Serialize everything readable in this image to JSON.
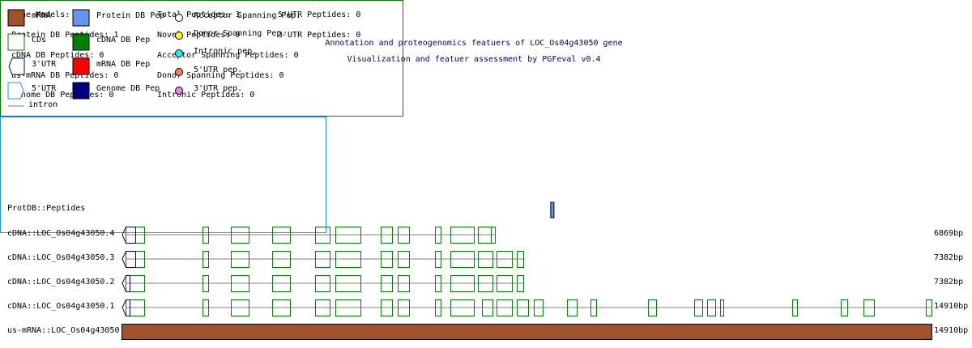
{
  "title": {
    "line1": "Annotation and proteogenomics featuers of LOC_Os04g43050 gene",
    "line2": "Visualization and featuer assessment by PGFeval v0.4"
  },
  "summary": [
    {
      "label": "Gene Models: 4"
    },
    {
      "label": "Total Peptides: 1"
    },
    {
      "label": "5'UTR Peptides: 0"
    },
    {
      "label": "Protein DB Peptides: 1"
    },
    {
      "label": "Novel Peptides: 0"
    },
    {
      "label": "3'UTR Peptides: 0"
    },
    {
      "label": "cDNA DB Peptides: 0"
    },
    {
      "label": "Acceptor Spanning Peptides: 0"
    },
    {
      "label": "us-mRNA DB Peptides: 0"
    },
    {
      "label": "Donor Spanning Peptides: 0"
    },
    {
      "label": "Genome DB Peptides: 0"
    },
    {
      "label": "Intronic Peptides: 0"
    }
  ],
  "legend": {
    "mrna": "mRNA",
    "cds": "CDs",
    "utr3": "3'UTR",
    "utr5": "5'UTR",
    "intron": "intron",
    "protdb": "Protein DB Pep",
    "cdnadb": "cDNA DB Pep",
    "mrnadb": "mRNA DB Pep",
    "genomedb": "Genome DB Pep",
    "acceptor": "Acceptor Spanning Pep.",
    "donor": "Donor Spanning Pep.",
    "intronic": "Intronic pep.",
    "utr5pep": "5'UTR pep.",
    "utr3pep": "3'UTR pep."
  },
  "colors": {
    "mrna": "#a0522d",
    "cds": "#008000",
    "utr3": "#000080",
    "utr5": "#1e90ff",
    "intron": "#c0c0c0",
    "protdb": "#6495ed",
    "cdnadb": "#008000",
    "mrnadb": "#ff0000",
    "genomedb": "#000080",
    "acceptor": "#ffffff",
    "donor": "#ffff00",
    "intronic": "#00ffff",
    "utr5pep": "#ff7f50",
    "utr3pep": "#ee82ee"
  },
  "gene_length_bp": 14910,
  "peptide_track": {
    "label": "ProtDB::Peptides",
    "peptides": [
      [
        7900,
        7960
      ]
    ]
  },
  "tracks": [
    {
      "label": "cDNA::LOC_Os04g43050.4",
      "length": "6869bp",
      "utr3": [
        75,
        253
      ],
      "exons": [
        [
          75,
          417
        ],
        [
          1491,
          1595
        ],
        [
          2013,
          2341
        ],
        [
          2773,
          3101
        ],
        [
          3563,
          3832
        ],
        [
          3936,
          4398
        ],
        [
          4771,
          4980
        ],
        [
          5084,
          5293
        ],
        [
          5770,
          5875
        ],
        [
          6053,
          6486
        ],
        [
          6560,
          6799
        ],
        [
          6799,
          6873
        ]
      ]
    },
    {
      "label": "cDNA::LOC_Os04g43050.3",
      "length": "7382bp",
      "utr3": [
        75,
        253
      ],
      "exons": [
        [
          75,
          417
        ],
        [
          1491,
          1595
        ],
        [
          2013,
          2341
        ],
        [
          2773,
          3101
        ],
        [
          3563,
          3832
        ],
        [
          3936,
          4398
        ],
        [
          4771,
          4980
        ],
        [
          5084,
          5293
        ],
        [
          5770,
          5875
        ],
        [
          6053,
          6486
        ],
        [
          6560,
          6829
        ],
        [
          6903,
          7187
        ],
        [
          7276,
          7395
        ]
      ]
    },
    {
      "label": "cDNA::LOC_Os04g43050.2",
      "length": "7382bp",
      "utr3": [
        75,
        149
      ],
      "exons": [
        [
          75,
          417
        ],
        [
          1491,
          1595
        ],
        [
          2013,
          2341
        ],
        [
          2773,
          3101
        ],
        [
          3563,
          3832
        ],
        [
          3936,
          4398
        ],
        [
          4771,
          4980
        ],
        [
          5084,
          5293
        ],
        [
          5770,
          5875
        ],
        [
          6053,
          6486
        ],
        [
          6560,
          6829
        ],
        [
          6903,
          7187
        ],
        [
          7276,
          7395
        ]
      ]
    },
    {
      "label": "cDNA::LOC_Os04g43050.1",
      "length": "14910bp",
      "utr3": [
        75,
        149
      ],
      "exons": [
        [
          75,
          417
        ],
        [
          1491,
          1595
        ],
        [
          2013,
          2341
        ],
        [
          2773,
          3101
        ],
        [
          3563,
          3832
        ],
        [
          3936,
          4398
        ],
        [
          4771,
          4980
        ],
        [
          5084,
          5293
        ],
        [
          5770,
          5875
        ],
        [
          6053,
          6486
        ],
        [
          6635,
          6829
        ],
        [
          6903,
          7187
        ],
        [
          7276,
          7485
        ],
        [
          7589,
          7753
        ],
        [
          8201,
          8379
        ],
        [
          8633,
          8737
        ],
        [
          9692,
          9841
        ],
        [
          10541,
          10690
        ],
        [
          10780,
          10929
        ],
        [
          11019,
          11078
        ],
        [
          12345,
          12435
        ],
        [
          13240,
          13360
        ],
        [
          13657,
          13851
        ],
        [
          14806,
          14910
        ]
      ]
    }
  ],
  "mrna_track": {
    "label": "us-mRNA::LOC_Os04g43050",
    "length": "14910bp"
  }
}
